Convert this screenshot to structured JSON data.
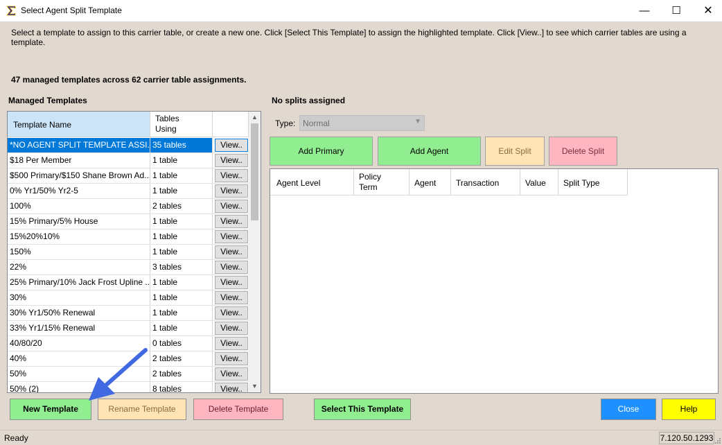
{
  "window": {
    "title": "Select Agent Split Template",
    "min_glyph": "—",
    "max_glyph": "☐",
    "close_glyph": "✕"
  },
  "instructions": "Select a template to assign to this carrier table, or create a new one. Click [Select This Template] to assign the highlighted template. Click [View..] to see which carrier tables are using a template.",
  "summary": "47 managed templates across 62 carrier table assignments.",
  "left": {
    "label": "Managed Templates",
    "columns": {
      "name": "Template Name",
      "tables_line1": "Tables",
      "tables_line2": "Using"
    },
    "view_label": "View..",
    "rows": [
      {
        "name": "*NO AGENT SPLIT TEMPLATE ASSI...",
        "tables": "35 tables"
      },
      {
        "name": "$18 Per Member",
        "tables": "1 table"
      },
      {
        "name": "$500 Primary/$150 Shane Brown Ad...",
        "tables": "1 table"
      },
      {
        "name": "0% Yr1/50% Yr2-5",
        "tables": "1 table"
      },
      {
        "name": "100%",
        "tables": "2 tables"
      },
      {
        "name": "15% Primary/5% House",
        "tables": "1 table"
      },
      {
        "name": "15%20%10%",
        "tables": "1 table"
      },
      {
        "name": "150%",
        "tables": "1 table"
      },
      {
        "name": "22%",
        "tables": "3 tables"
      },
      {
        "name": "25% Primary/10% Jack Frost Upline ...",
        "tables": "1 table"
      },
      {
        "name": "30%",
        "tables": "1 table"
      },
      {
        "name": "30% Yr1/50% Renewal",
        "tables": "1 table"
      },
      {
        "name": "33% Yr1/15% Renewal",
        "tables": "1 table"
      },
      {
        "name": "40/80/20",
        "tables": "0 tables"
      },
      {
        "name": "40%",
        "tables": "2 tables"
      },
      {
        "name": "50%",
        "tables": "2 tables"
      },
      {
        "name": "50% (2)",
        "tables": "8 tables"
      }
    ]
  },
  "right": {
    "label": "No splits assigned",
    "type_label": "Type:",
    "type_value": "Normal",
    "buttons": {
      "add_primary": "Add Primary",
      "add_agent": "Add Agent",
      "edit_split": "Edit Split",
      "delete_split": "Delete Split"
    },
    "columns": {
      "agent_level": "Agent Level",
      "policy_term_1": "Policy",
      "policy_term_2": "Term",
      "agent": "Agent",
      "transaction": "Transaction",
      "value": "Value",
      "split_type": "Split Type"
    }
  },
  "bottom": {
    "new_template": "New Template",
    "rename_template": "Rename Template",
    "delete_template": "Delete Template",
    "select_template": "Select This Template",
    "close": "Close",
    "help": "Help"
  },
  "status": {
    "left": "Ready",
    "version": "7.120.50.1293"
  },
  "colors": {
    "background": "#e1d8cf",
    "selection": "#0078d7",
    "green_button": "#90ee90",
    "tan_button": "#ffe4b5",
    "pink_button": "#ffb6c1",
    "close_button": "#1e90ff",
    "help_button": "#ffff00",
    "annotation_arrow": "#4169e1"
  }
}
